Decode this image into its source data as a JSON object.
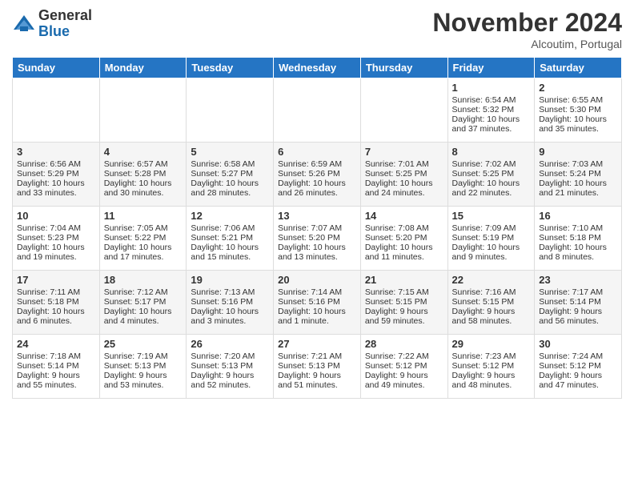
{
  "logo": {
    "general": "General",
    "blue": "Blue"
  },
  "header": {
    "month": "November 2024",
    "location": "Alcoutim, Portugal"
  },
  "weekdays": [
    "Sunday",
    "Monday",
    "Tuesday",
    "Wednesday",
    "Thursday",
    "Friday",
    "Saturday"
  ],
  "weeks": [
    [
      {
        "num": "",
        "content": ""
      },
      {
        "num": "",
        "content": ""
      },
      {
        "num": "",
        "content": ""
      },
      {
        "num": "",
        "content": ""
      },
      {
        "num": "",
        "content": ""
      },
      {
        "num": "1",
        "content": "Sunrise: 6:54 AM\nSunset: 5:32 PM\nDaylight: 10 hours and 37 minutes."
      },
      {
        "num": "2",
        "content": "Sunrise: 6:55 AM\nSunset: 5:30 PM\nDaylight: 10 hours and 35 minutes."
      }
    ],
    [
      {
        "num": "3",
        "content": "Sunrise: 6:56 AM\nSunset: 5:29 PM\nDaylight: 10 hours and 33 minutes."
      },
      {
        "num": "4",
        "content": "Sunrise: 6:57 AM\nSunset: 5:28 PM\nDaylight: 10 hours and 30 minutes."
      },
      {
        "num": "5",
        "content": "Sunrise: 6:58 AM\nSunset: 5:27 PM\nDaylight: 10 hours and 28 minutes."
      },
      {
        "num": "6",
        "content": "Sunrise: 6:59 AM\nSunset: 5:26 PM\nDaylight: 10 hours and 26 minutes."
      },
      {
        "num": "7",
        "content": "Sunrise: 7:01 AM\nSunset: 5:25 PM\nDaylight: 10 hours and 24 minutes."
      },
      {
        "num": "8",
        "content": "Sunrise: 7:02 AM\nSunset: 5:25 PM\nDaylight: 10 hours and 22 minutes."
      },
      {
        "num": "9",
        "content": "Sunrise: 7:03 AM\nSunset: 5:24 PM\nDaylight: 10 hours and 21 minutes."
      }
    ],
    [
      {
        "num": "10",
        "content": "Sunrise: 7:04 AM\nSunset: 5:23 PM\nDaylight: 10 hours and 19 minutes."
      },
      {
        "num": "11",
        "content": "Sunrise: 7:05 AM\nSunset: 5:22 PM\nDaylight: 10 hours and 17 minutes."
      },
      {
        "num": "12",
        "content": "Sunrise: 7:06 AM\nSunset: 5:21 PM\nDaylight: 10 hours and 15 minutes."
      },
      {
        "num": "13",
        "content": "Sunrise: 7:07 AM\nSunset: 5:20 PM\nDaylight: 10 hours and 13 minutes."
      },
      {
        "num": "14",
        "content": "Sunrise: 7:08 AM\nSunset: 5:20 PM\nDaylight: 10 hours and 11 minutes."
      },
      {
        "num": "15",
        "content": "Sunrise: 7:09 AM\nSunset: 5:19 PM\nDaylight: 10 hours and 9 minutes."
      },
      {
        "num": "16",
        "content": "Sunrise: 7:10 AM\nSunset: 5:18 PM\nDaylight: 10 hours and 8 minutes."
      }
    ],
    [
      {
        "num": "17",
        "content": "Sunrise: 7:11 AM\nSunset: 5:18 PM\nDaylight: 10 hours and 6 minutes."
      },
      {
        "num": "18",
        "content": "Sunrise: 7:12 AM\nSunset: 5:17 PM\nDaylight: 10 hours and 4 minutes."
      },
      {
        "num": "19",
        "content": "Sunrise: 7:13 AM\nSunset: 5:16 PM\nDaylight: 10 hours and 3 minutes."
      },
      {
        "num": "20",
        "content": "Sunrise: 7:14 AM\nSunset: 5:16 PM\nDaylight: 10 hours and 1 minute."
      },
      {
        "num": "21",
        "content": "Sunrise: 7:15 AM\nSunset: 5:15 PM\nDaylight: 9 hours and 59 minutes."
      },
      {
        "num": "22",
        "content": "Sunrise: 7:16 AM\nSunset: 5:15 PM\nDaylight: 9 hours and 58 minutes."
      },
      {
        "num": "23",
        "content": "Sunrise: 7:17 AM\nSunset: 5:14 PM\nDaylight: 9 hours and 56 minutes."
      }
    ],
    [
      {
        "num": "24",
        "content": "Sunrise: 7:18 AM\nSunset: 5:14 PM\nDaylight: 9 hours and 55 minutes."
      },
      {
        "num": "25",
        "content": "Sunrise: 7:19 AM\nSunset: 5:13 PM\nDaylight: 9 hours and 53 minutes."
      },
      {
        "num": "26",
        "content": "Sunrise: 7:20 AM\nSunset: 5:13 PM\nDaylight: 9 hours and 52 minutes."
      },
      {
        "num": "27",
        "content": "Sunrise: 7:21 AM\nSunset: 5:13 PM\nDaylight: 9 hours and 51 minutes."
      },
      {
        "num": "28",
        "content": "Sunrise: 7:22 AM\nSunset: 5:12 PM\nDaylight: 9 hours and 49 minutes."
      },
      {
        "num": "29",
        "content": "Sunrise: 7:23 AM\nSunset: 5:12 PM\nDaylight: 9 hours and 48 minutes."
      },
      {
        "num": "30",
        "content": "Sunrise: 7:24 AM\nSunset: 5:12 PM\nDaylight: 9 hours and 47 minutes."
      }
    ]
  ]
}
